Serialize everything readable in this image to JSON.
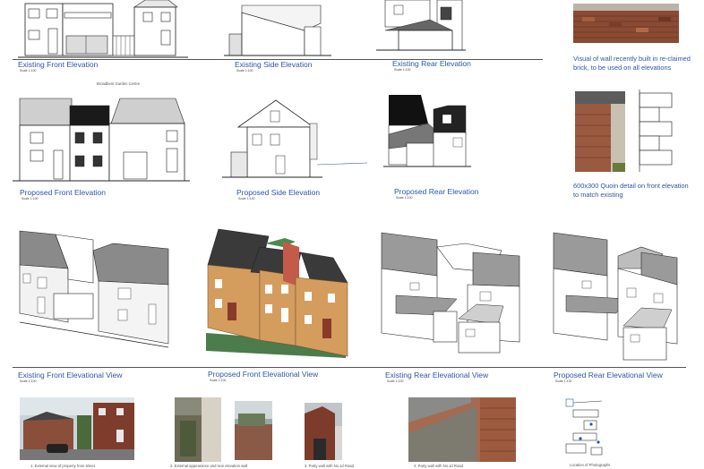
{
  "row1": {
    "front": {
      "title": "Existing Front Elevation",
      "scale": "Scale 1:100"
    },
    "side": {
      "title": "Existing Side Elevation",
      "scale": "Scale 1:100"
    },
    "rear": {
      "title": "Existing Rear Elevation",
      "scale": "Scale 1:100"
    },
    "brick_note": "Visual of wall recently built in re-claimed brick, to be used on all elevations",
    "sign_text": "Broadbent Garden Centre"
  },
  "row2": {
    "front": {
      "title": "Proposed Front Elevation",
      "scale": "Scale 1:100"
    },
    "side": {
      "title": "Proposed Side Elevation",
      "scale": "Scale 1:100"
    },
    "rear": {
      "title": "Proposed Rear Elevation",
      "scale": "Scale 1:100"
    },
    "quoin_note": "600x300 Quoin detail on front elevation to match existing"
  },
  "row3": {
    "v1": {
      "title": "Existing Front Elevational View",
      "scale": "Scale 1:100"
    },
    "v2": {
      "title": "Proposed Front Elevational View",
      "scale": "Scale 1:100"
    },
    "v3": {
      "title": "Existing Rear Elevational View",
      "scale": "Scale 1:100"
    },
    "v4": {
      "title": "Proposed Rear Elevational View",
      "scale": "Scale 1:100"
    }
  },
  "photos": {
    "p1": "1. External view of property from street",
    "p2": "2. External appearance and rear elevation wall",
    "p3": "3. Party wall with No.1d Road",
    "p4": "4. Party wall with No.1d Road",
    "p5": "Location of Photographs"
  },
  "colors": {
    "caption": "#2b55a6",
    "brick": "#a0553b",
    "roof": "#3b3b3b"
  }
}
